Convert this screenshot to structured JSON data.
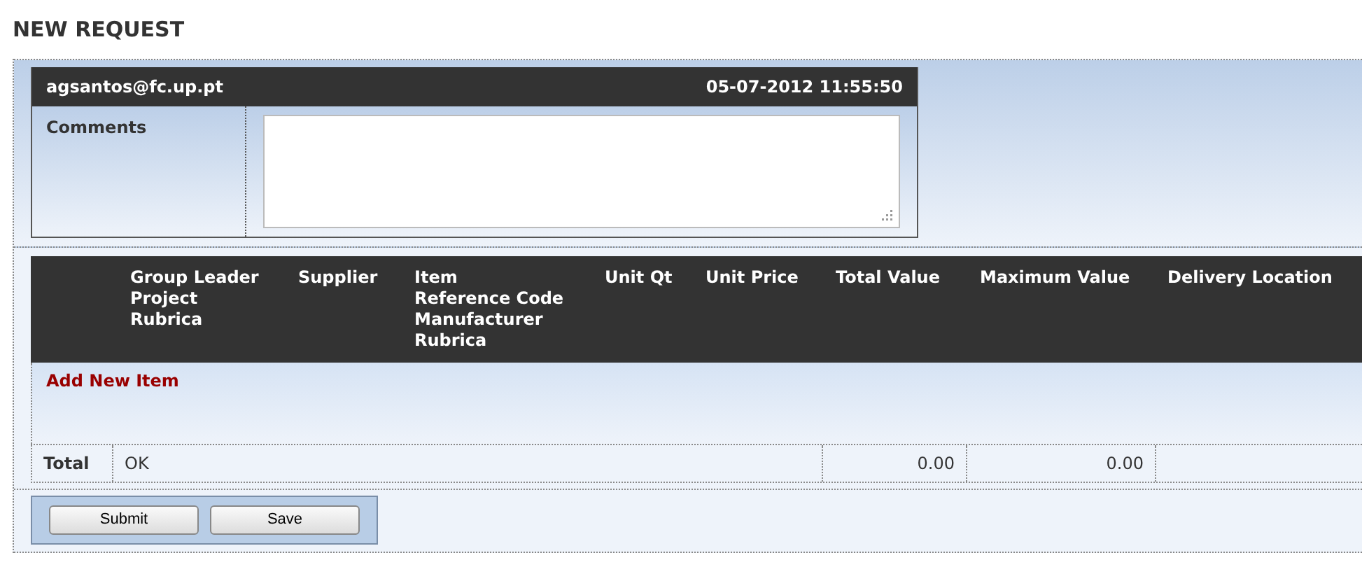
{
  "title": "NEW REQUEST",
  "request": {
    "user": "agsantos@fc.up.pt",
    "datetime": "05-07-2012 11:55:50",
    "comments_label": "Comments"
  },
  "items_table": {
    "columns": [
      {
        "lines": [
          "Group Leader",
          "Project",
          "Rubrica"
        ]
      },
      {
        "lines": [
          "Supplier"
        ]
      },
      {
        "lines": [
          "Item",
          "Reference Code",
          "Manufacturer",
          "Rubrica"
        ]
      },
      {
        "lines": [
          "Unit Qt"
        ]
      },
      {
        "lines": [
          "Unit Price"
        ]
      },
      {
        "lines": [
          "Total Value"
        ]
      },
      {
        "lines": [
          "Maximum Value"
        ]
      },
      {
        "lines": [
          "Delivery Location"
        ]
      }
    ],
    "add_link": "Add New Item",
    "total_row": {
      "label": "Total",
      "status": "OK",
      "total_value": "0.00",
      "maximum_value": "0.00"
    }
  },
  "buttons": [
    "Submit",
    "Save"
  ]
}
